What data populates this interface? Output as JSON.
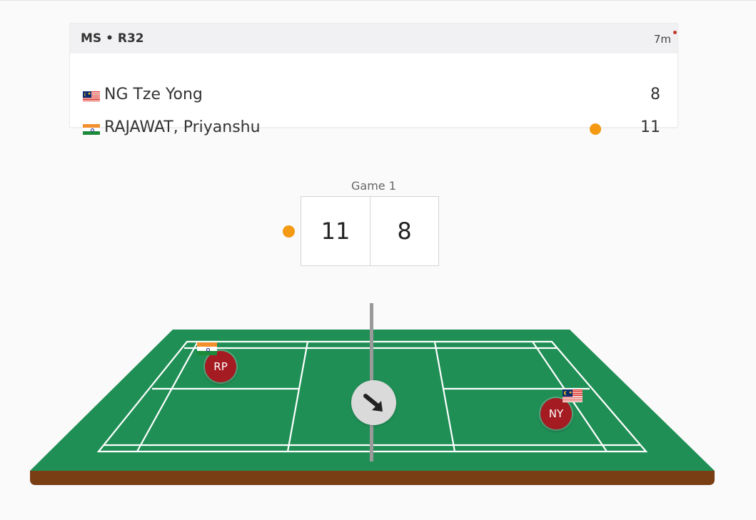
{
  "match": {
    "round": "MS • R32",
    "elapsed": "7m",
    "players": [
      {
        "name": "NG Tze Yong",
        "flag": "malaysia-flag-icon",
        "score": "8",
        "serving": false
      },
      {
        "name": "RAJAWAT, Priyanshu",
        "flag": "india-flag-icon",
        "score": "11",
        "serving": true
      }
    ]
  },
  "game": {
    "label": "Game 1",
    "left_score": "11",
    "right_score": "8",
    "serving_side": "left"
  },
  "court": {
    "left_player": {
      "initials": "RP",
      "flag": "india-flag-icon"
    },
    "right_player": {
      "initials": "NY",
      "flag": "malaysia-flag-icon"
    },
    "shuttle_icon": "shuttle-direction-arrow-icon",
    "colors": {
      "court": "#1f8f55",
      "court_edge": "#7a3e15",
      "lines": "#ffffff",
      "badge": "#a51b22",
      "serve": "#f39a12"
    }
  }
}
